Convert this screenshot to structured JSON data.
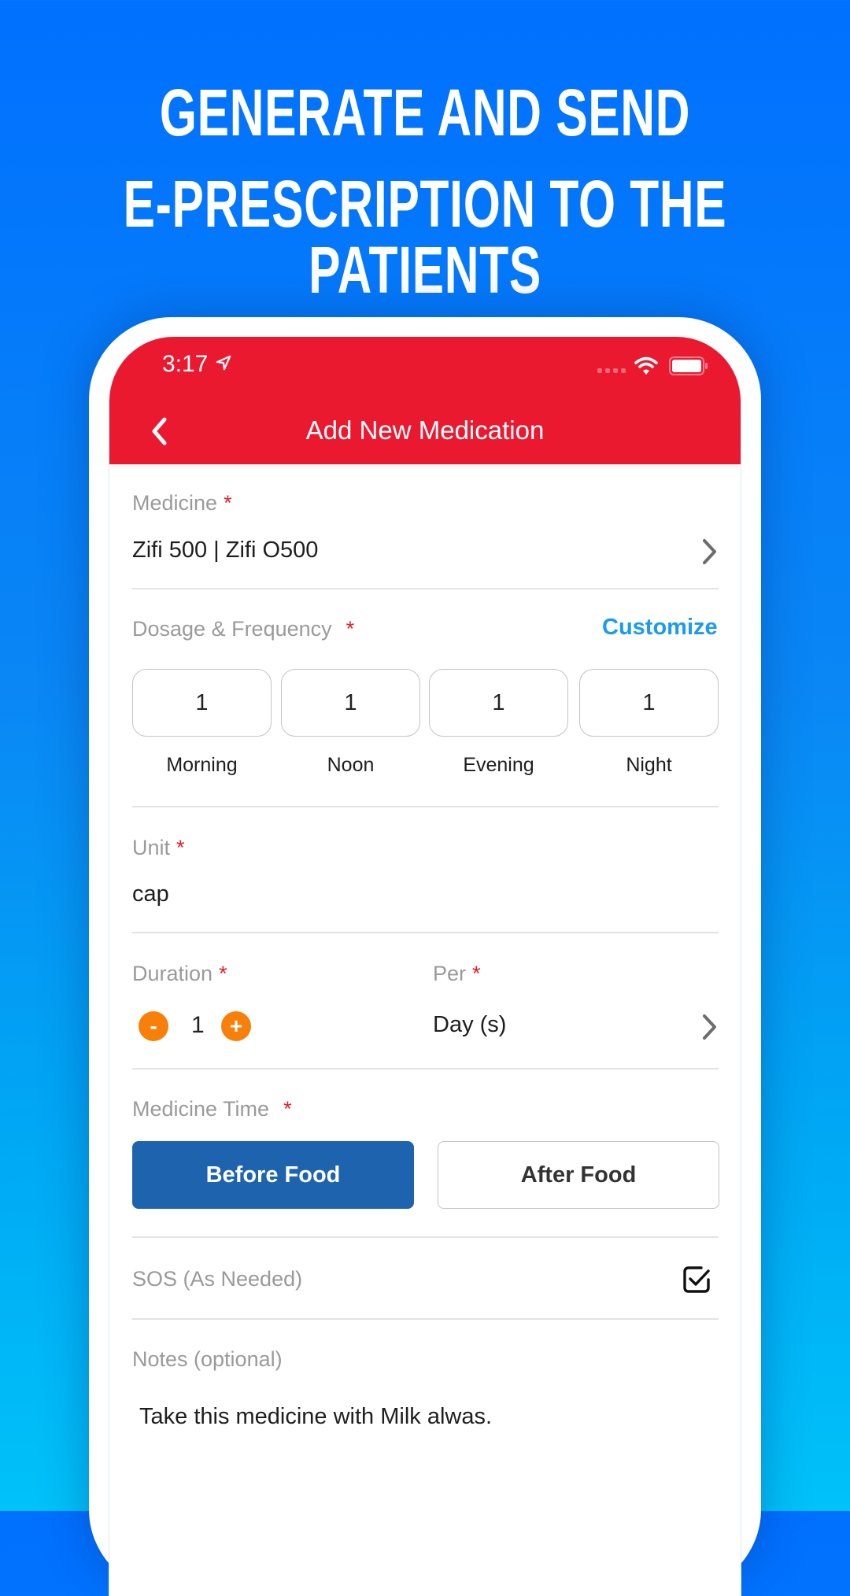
{
  "headline": {
    "line1": "GENERATE AND SEND",
    "line2": "E-PRESCRIPTION TO THE PATIENTS"
  },
  "status_bar": {
    "time": "3:17",
    "icons": [
      "location-arrow-icon",
      "signal-dots-icon",
      "wifi-icon",
      "battery-icon"
    ]
  },
  "app_bar": {
    "title": "Add New Medication",
    "back_icon": "chevron-left-icon"
  },
  "colors": {
    "app_bar": "#ea1930",
    "accent_link": "#1a9bef",
    "selected_button": "#1e63ae",
    "stepper": "#f77f0a",
    "required_marker": "#e31e24"
  },
  "form": {
    "medicine": {
      "label": "Medicine",
      "required": "*",
      "value": "Zifi 500 | Zifi O500"
    },
    "dosage": {
      "label": "Dosage & Frequency",
      "required": "*",
      "customize_label": "Customize",
      "slots": [
        {
          "label": "Morning",
          "value": "1"
        },
        {
          "label": "Noon",
          "value": "1"
        },
        {
          "label": "Evening",
          "value": "1"
        },
        {
          "label": "Night",
          "value": "1"
        }
      ]
    },
    "unit": {
      "label": "Unit",
      "required": "*",
      "value": "cap"
    },
    "duration": {
      "label": "Duration",
      "required": "*",
      "value": "1",
      "minus": "-",
      "plus": "+"
    },
    "per": {
      "label": "Per",
      "required": "*",
      "value": "Day (s)"
    },
    "medicine_time": {
      "label": "Medicine Time",
      "required": "*",
      "options": [
        "Before Food",
        "After Food"
      ],
      "selected": "Before Food"
    },
    "sos": {
      "label": "SOS (As Needed)",
      "checked": true
    },
    "notes": {
      "label": "Notes (optional)",
      "value": "Take this medicine with Milk alwas."
    }
  }
}
